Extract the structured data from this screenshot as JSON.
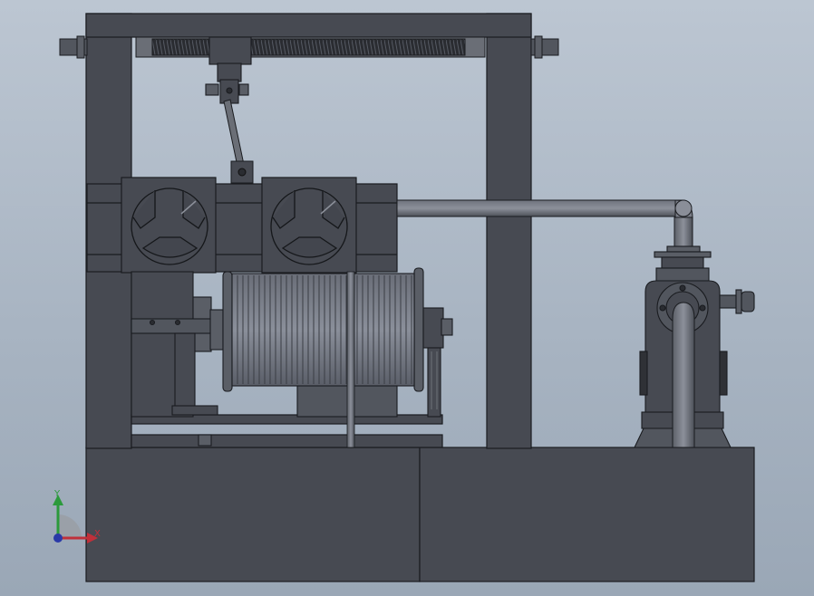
{
  "viewport": {
    "background_top": "#bcc6d2",
    "background_bottom": "#9aa7b6",
    "part_color": "#474a52",
    "edge_color": "#1a1c20"
  },
  "triad": {
    "y_label": "Y",
    "x_label": "X",
    "y_color": "#2c9a3c",
    "x_color": "#c0303a",
    "z_color": "#2a3aa8"
  },
  "assembly": {
    "parts": [
      "frame",
      "lead-screw",
      "traverse-carriage",
      "rope-guide-rod",
      "pulley-housing",
      "cable-drum",
      "drive-motor",
      "pipe",
      "pump",
      "base"
    ]
  }
}
